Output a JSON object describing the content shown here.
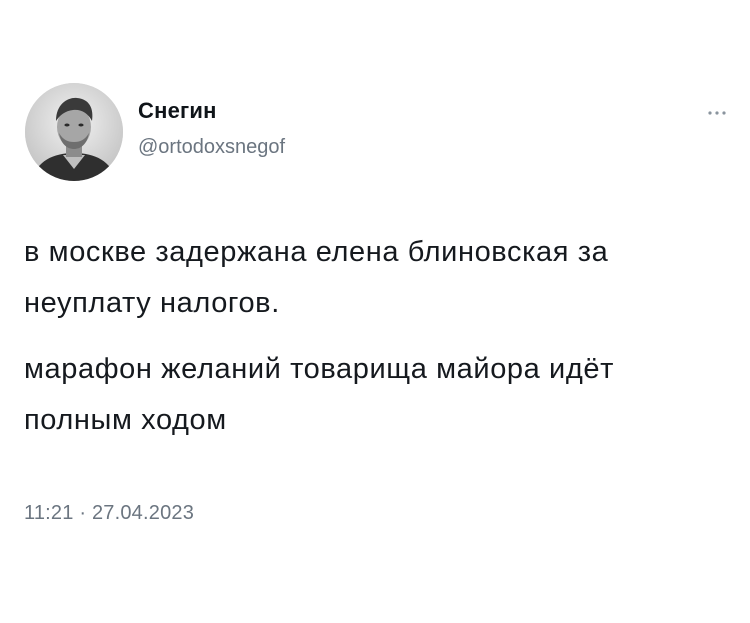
{
  "author": {
    "display_name": "Снегин",
    "username": "@ortodoxsnegof",
    "avatar_icon": "user-photo-avatar"
  },
  "tweet": {
    "paragraph_1": "в москве задержана елена блиновская за неуплату налогов.",
    "paragraph_2": "марафон желаний товарища майора идёт полным ходом"
  },
  "meta": {
    "timestamp": "11:21 · 27.04.2023"
  },
  "icons": {
    "more": "more-horizontal-icon"
  },
  "colors": {
    "text": "#0f1419",
    "secondary": "#6b7580",
    "background": "#ffffff"
  }
}
